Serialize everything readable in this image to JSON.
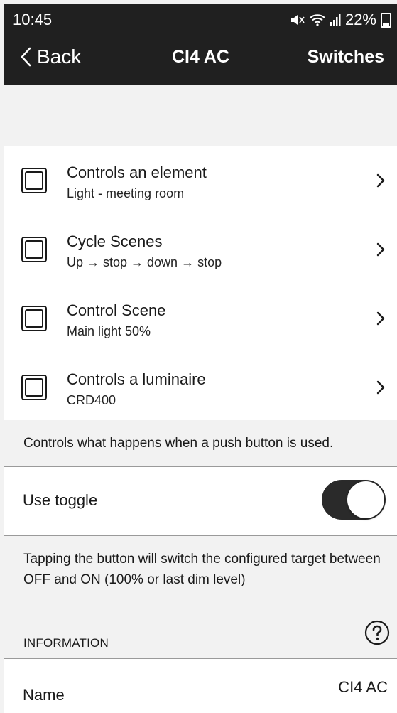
{
  "status_bar": {
    "time": "10:45",
    "battery": "22%"
  },
  "nav": {
    "back_label": "Back",
    "title": "CI4 AC",
    "right_label": "Switches"
  },
  "options": [
    {
      "title": "Controls an element",
      "subtitle": "Light - meeting room"
    },
    {
      "title": "Cycle Scenes",
      "subtitle": "Up → stop → down → stop"
    },
    {
      "title": "Control Scene",
      "subtitle": "Main light 50%"
    },
    {
      "title": "Controls a luminaire",
      "subtitle": "CRD400"
    }
  ],
  "description": "Controls what happens when a push button is used.",
  "toggle": {
    "label": "Use toggle",
    "on": true
  },
  "toggle_help": "Tapping the button will switch the configured target between OFF and ON (100% or last dim level)",
  "information": {
    "header": "INFORMATION"
  },
  "name_field": {
    "label": "Name",
    "value": "CI4 AC"
  }
}
